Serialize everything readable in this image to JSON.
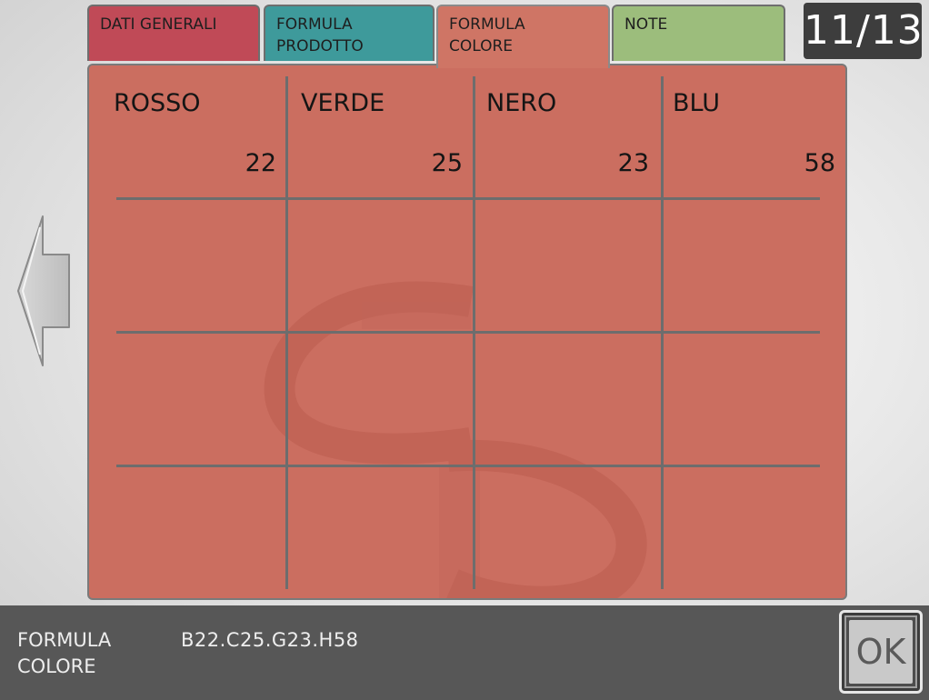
{
  "tabs": [
    {
      "line1": "DATI GENERALI",
      "line2": "",
      "color": "#c04a57"
    },
    {
      "line1": "FORMULA",
      "line2": "PRODOTTO",
      "color": "#3e9a9b"
    },
    {
      "line1": "FORMULA",
      "line2": "COLORE",
      "color": "#cf7565",
      "active": true
    },
    {
      "line1": "NOTE",
      "line2": "",
      "color": "#9cbd7c"
    }
  ],
  "page_counter": "11/13",
  "grid": {
    "columns": [
      {
        "name": "ROSSO",
        "value": "22"
      },
      {
        "name": "VERDE",
        "value": "25"
      },
      {
        "name": "NERO",
        "value": "23"
      },
      {
        "name": "BLU",
        "value": "58"
      }
    ],
    "empty_rows": 3
  },
  "navigation": {
    "back_icon": "left-arrow-icon"
  },
  "footer": {
    "formula_label_line1": "FORMULA",
    "formula_label_line2": "COLORE",
    "formula_value": "B22.C25.G23.H58",
    "ok_label": "OK"
  },
  "colors": {
    "panel": "#cb6e60",
    "grid_lines": "#6d6d6d",
    "footer_bg": "#575757",
    "counter_bg": "#3d3d3d"
  }
}
